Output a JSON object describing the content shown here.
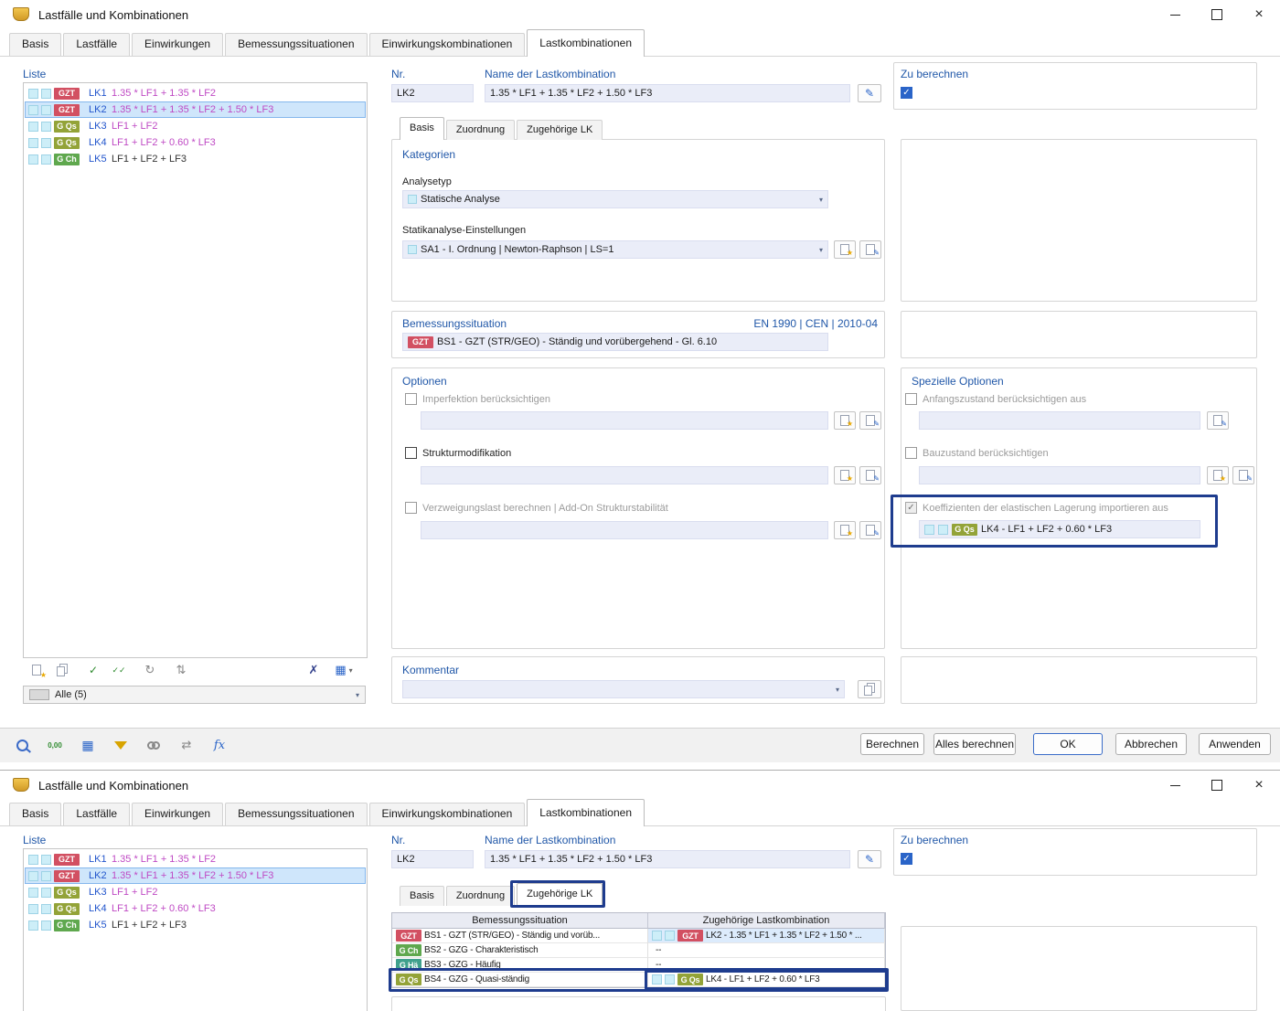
{
  "title": "Lastfälle und Kombinationen",
  "main_tabs": [
    "Basis",
    "Lastfälle",
    "Einwirkungen",
    "Bemessungssituationen",
    "Einwirkungskombinationen",
    "Lastkombinationen"
  ],
  "inner_tabs": [
    "Basis",
    "Zuordnung",
    "Zugehörige LK"
  ],
  "list": {
    "label": "Liste",
    "filter": "Alle (5)",
    "items": [
      {
        "badge": "GZT",
        "id": "LK1",
        "formula": "1.35 * LF1 + 1.35 * LF2"
      },
      {
        "badge": "GZT",
        "id": "LK2",
        "formula": "1.35 * LF1 + 1.35 * LF2 + 1.50 * LF3"
      },
      {
        "badge": "G Qs",
        "id": "LK3",
        "formula": "LF1 + LF2"
      },
      {
        "badge": "G Qs",
        "id": "LK4",
        "formula": "LF1 + LF2 + 0.60 * LF3"
      },
      {
        "badge": "G Ch",
        "id": "LK5",
        "formula": "LF1 + LF2 + LF3"
      }
    ]
  },
  "header_fields": {
    "nr_label": "Nr.",
    "nr_value": "LK2",
    "name_label": "Name der Lastkombination",
    "name_value": "1.35 * LF1 + 1.35 * LF2 + 1.50 * LF3",
    "compute_label": "Zu berechnen"
  },
  "basis_tab": {
    "kategorien_label": "Kategorien",
    "analysetyp_label": "Analysetyp",
    "analysetyp_value": "Statische Analyse",
    "statik_label": "Statikanalyse-Einstellungen",
    "statik_value": "SA1 - I. Ordnung | Newton-Raphson | LS=1",
    "bemessung_label": "Bemessungssituation",
    "norm": "EN 1990 | CEN | 2010-04",
    "bs_badge": "GZT",
    "bs_value": "BS1 - GZT (STR/GEO) - Ständig und vorübergehend - Gl. 6.10",
    "optionen_label": "Optionen",
    "opt_imperfektion": "Imperfektion berücksichtigen",
    "opt_strukturmodifikation": "Strukturmodifikation",
    "opt_verzweigungslast": "Verzweigungslast berechnen | Add-On Strukturstabilität",
    "spezielle_label": "Spezielle Optionen",
    "opt_anfangszustand": "Anfangszustand berücksichtigen aus",
    "opt_bauzustand": "Bauzustand berücksichtigen",
    "opt_koeffizienten": "Koeffizienten der elastischen Lagerung importieren aus",
    "koeff_badge": "G Qs",
    "koeff_value": "LK4 - LF1 + LF2 + 0.60 * LF3",
    "kommentar_label": "Kommentar"
  },
  "zugehoerige_tab": {
    "col_situation": "Bemessungssituation",
    "col_kombination": "Zugehörige Lastkombination",
    "rows": [
      {
        "badge": "GZT",
        "situation": "BS1 - GZT (STR/GEO) - Ständig und vorüb...",
        "lk_badge": "GZT",
        "lk": "LK2 - 1.35 * LF1 + 1.35 * LF2 + 1.50 * ..."
      },
      {
        "badge": "G Ch",
        "situation": "BS2 - GZG - Charakteristisch",
        "lk": "--"
      },
      {
        "badge": "G Hä",
        "situation": "BS3 - GZG - Häufig",
        "lk": "--"
      },
      {
        "badge": "G Qs",
        "situation": "BS4 - GZG - Quasi-ständig",
        "lk_badge": "G Qs",
        "lk": "LK4 - LF1 + LF2 + 0.60 * LF3"
      }
    ]
  },
  "footer": {
    "berechnen": "Berechnen",
    "alles_berechnen": "Alles berechnen",
    "ok": "OK",
    "abbrechen": "Abbrechen",
    "anwenden": "Anwenden"
  },
  "icons": {
    "chevron": "▾",
    "check": "✓",
    "double_check": "✓✓",
    "refresh": "↻",
    "sort": "⇅",
    "delete": "✗",
    "grid": "▦",
    "swap": "⇄",
    "decimal": "0,00",
    "fx": "fx",
    "pencil": "✎",
    "star": "★",
    "close": "×"
  },
  "colors": {
    "badge_gzt": "#d25062",
    "badge_gqs": "#93a338",
    "badge_gch": "#5fa84e",
    "badge_gha": "#3fa08c",
    "accent": "#2057a8",
    "highlight_border": "#1e3c8e",
    "selection_bg": "#cfe6fb"
  }
}
